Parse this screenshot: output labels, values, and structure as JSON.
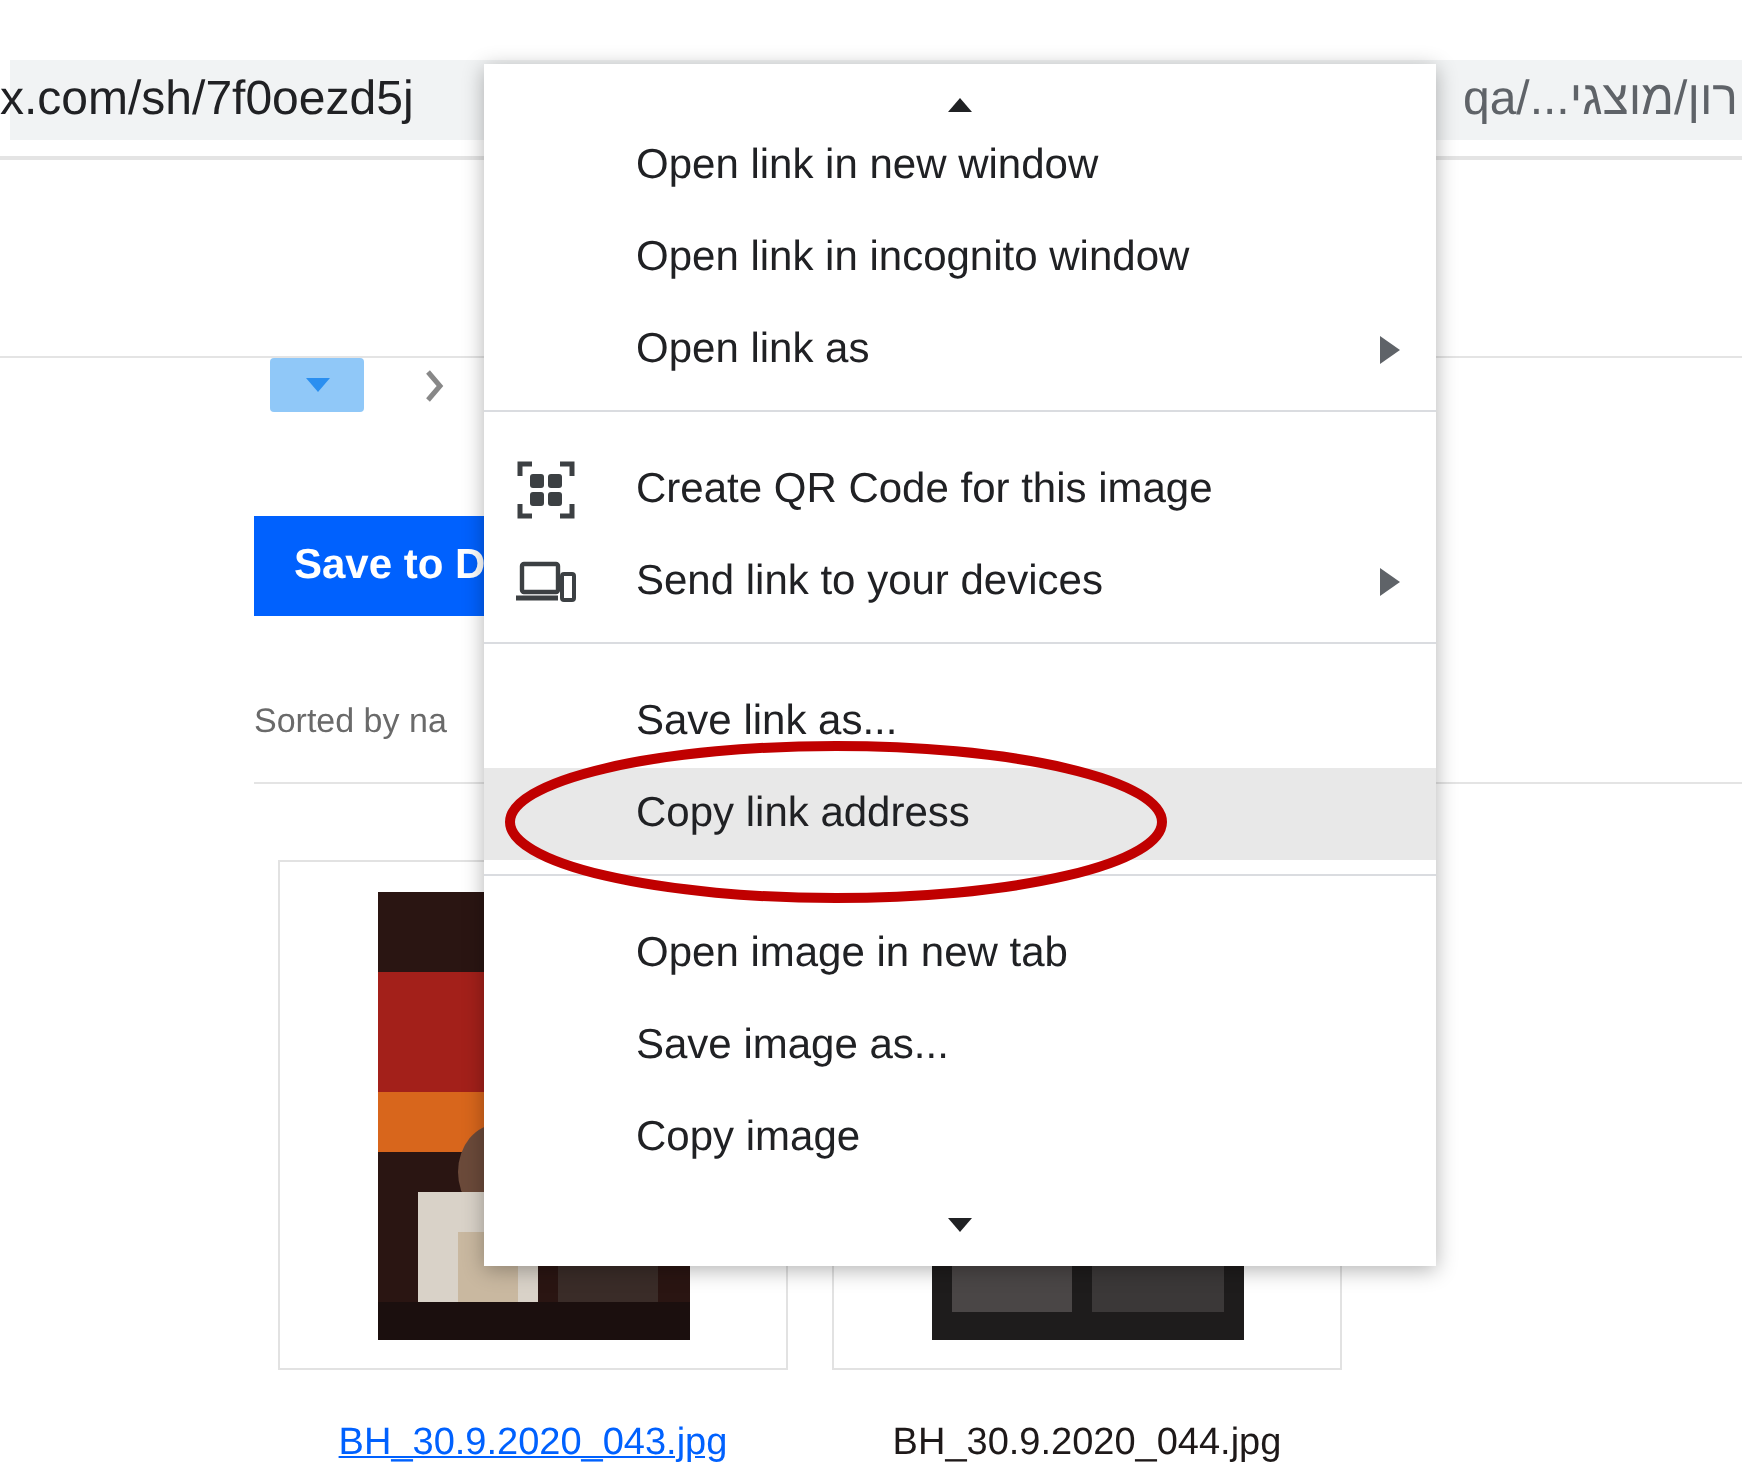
{
  "address_bar": {
    "left_text": "x.com/sh/7f0oezd5j",
    "right_text": "qa/...רון/מוצגי"
  },
  "toolbar": {
    "save_button": "Save to D",
    "sort_label": "Sorted by na"
  },
  "files": [
    {
      "name": "BH_30.9.2020_043.jpg",
      "link": true
    },
    {
      "name": "BH_30.9.2020_044.jpg",
      "link": false
    }
  ],
  "context_menu": {
    "items": [
      {
        "kind": "scroll_up"
      },
      {
        "kind": "item",
        "label": "Open link in new window",
        "submenu": false,
        "selected": false
      },
      {
        "kind": "item",
        "label": "Open link in incognito window",
        "submenu": false,
        "selected": false
      },
      {
        "kind": "item",
        "label": "Open link as",
        "submenu": true,
        "selected": false
      },
      {
        "kind": "separator"
      },
      {
        "kind": "qr",
        "label": "Create QR Code for this image",
        "submenu": false,
        "selected": false
      },
      {
        "kind": "devices",
        "label": "Send link to your devices",
        "submenu": true,
        "selected": false
      },
      {
        "kind": "separator"
      },
      {
        "kind": "item",
        "label": "Save link as...",
        "submenu": false,
        "selected": false
      },
      {
        "kind": "item",
        "label": "Copy link address",
        "submenu": false,
        "selected": true,
        "circled": true
      },
      {
        "kind": "separator"
      },
      {
        "kind": "item",
        "label": "Open image in new tab",
        "submenu": false,
        "selected": false
      },
      {
        "kind": "item",
        "label": "Save image as...",
        "submenu": false,
        "selected": false
      },
      {
        "kind": "item",
        "label": "Copy image",
        "submenu": false,
        "selected": false
      },
      {
        "kind": "scroll_down"
      }
    ]
  }
}
